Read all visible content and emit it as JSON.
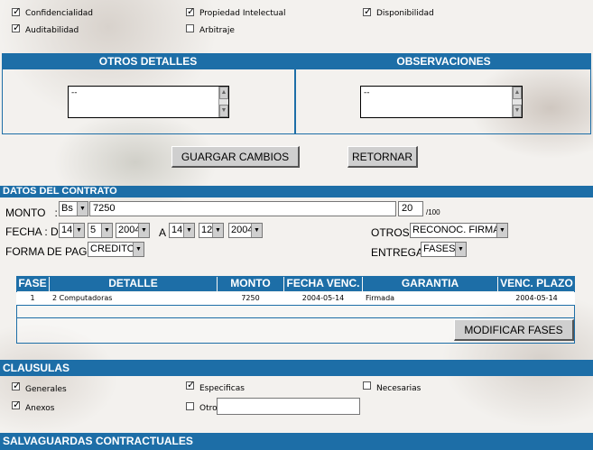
{
  "top_checks": [
    {
      "label": "Confidencialidad",
      "checked": true
    },
    {
      "label": "Propiedad Intelectual",
      "checked": true
    },
    {
      "label": "Disponibilidad",
      "checked": true
    },
    {
      "label": "Auditabilidad",
      "checked": true
    },
    {
      "label": "Arbitraje",
      "checked": false
    }
  ],
  "details": {
    "otros_header": "OTROS DETALLES",
    "obs_header": "OBSERVACIONES",
    "otros_value": "--",
    "obs_value": "--"
  },
  "actions": {
    "save": "GUARGAR CAMBIOS",
    "back": "RETORNAR"
  },
  "contrato": {
    "title": "DATOS DEL CONTRATO",
    "monto_label": "MONTO   :",
    "currency": "Bs",
    "monto_value": "7250",
    "cents": "20",
    "cents_suffix": "/100",
    "fecha_label": "FECHA : DE",
    "from_day": "14",
    "from_month": "5",
    "from_year": "2004",
    "a_label": "A",
    "to_day": "14",
    "to_month": "12",
    "to_year": "2004",
    "otros_label": "OTROS :",
    "otros_value": "RECONOC. FIRMAS",
    "pago_label": "FORMA DE PAGO :",
    "pago_value": "CREDITO",
    "entrega_label": "ENTREGA :",
    "entrega_value": "FASES"
  },
  "fases": {
    "headers": [
      "FASE",
      "DETALLE",
      "MONTO",
      "FECHA VENC.",
      "GARANTIA",
      "VENC. PLAZO"
    ],
    "rows": [
      {
        "fase": "1",
        "detalle": "2 Computadoras",
        "monto": "7250",
        "fecha": "2004-05-14",
        "garantia": "Firmada",
        "plazo": "2004-05-14"
      }
    ],
    "modify": "MODIFICAR FASES"
  },
  "clausulas": {
    "title": "CLAUSULAS",
    "items": [
      {
        "label": "Generales",
        "checked": true
      },
      {
        "label": "Especificas",
        "checked": true
      },
      {
        "label": "Necesarias",
        "checked": false
      },
      {
        "label": "Anexos",
        "checked": true
      },
      {
        "label": "Otros",
        "checked": false
      }
    ],
    "otros_value": ""
  },
  "salvaguardas": {
    "title": "SALVAGUARDAS CONTRACTUALES"
  }
}
